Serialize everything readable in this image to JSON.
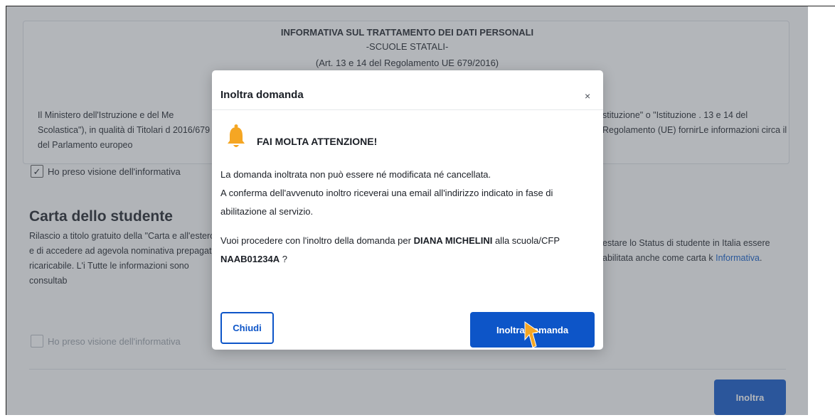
{
  "info": {
    "title": "INFORMATIVA SUL TRATTAMENTO DEI DATI PERSONALI",
    "subtitle": "-SCUOLE STATALI-",
    "ref": "(Art. 13 e 14 del Regolamento UE 679/2016)",
    "text_left": "Il Ministero dell'Istruzione e del Me Scolastica\"), in qualità di Titolari d 2016/679 del Parlamento europeo",
    "text_right": "stituzione\" o \"Istituzione . 13 e 14 del Regolamento (UE) fornirLe informazioni circa il"
  },
  "consent1": {
    "label": "Ho preso visione dell'informativa",
    "checked_glyph": "✓"
  },
  "carta": {
    "title": "Carta dello studente",
    "text_left": "Rilascio a titolo gratuito della \"Carta e all'estero e di accedere ad agevola nominativa prepagata ricaricabile. L'i Tutte le informazioni sono consultab",
    "text_right_1": "estare lo Status di studente in Italia essere abilitata anche come carta k",
    "link": "Informativa",
    "text_right_end": "."
  },
  "consent2": {
    "label": "Ho preso visione dell'informativa"
  },
  "page_button": "Inoltra",
  "modal": {
    "title": "Inoltra domanda",
    "close_glyph": "×",
    "warning_title": "FAI MOLTA ATTENZIONE!",
    "p1_line1": "La domanda inoltrata non può essere né modificata né cancellata.",
    "p1_line2": "A conferma dell'avvenuto inoltro riceverai una email all'indirizzo indicato in fase di abilitazione al servizio.",
    "p2_before": "Vuoi procedere con l'inoltro della domanda per",
    "p2_name": "DIANA MICHELINI",
    "p2_mid": "alla scuola/CFP",
    "p2_code": "NAAB01234A",
    "p2_end": "?",
    "close_button": "Chiudi",
    "send_button": "Inoltra domanda"
  },
  "colors": {
    "primary": "#0d55c8",
    "overlay": "#525862",
    "bell": "#f5a623"
  }
}
